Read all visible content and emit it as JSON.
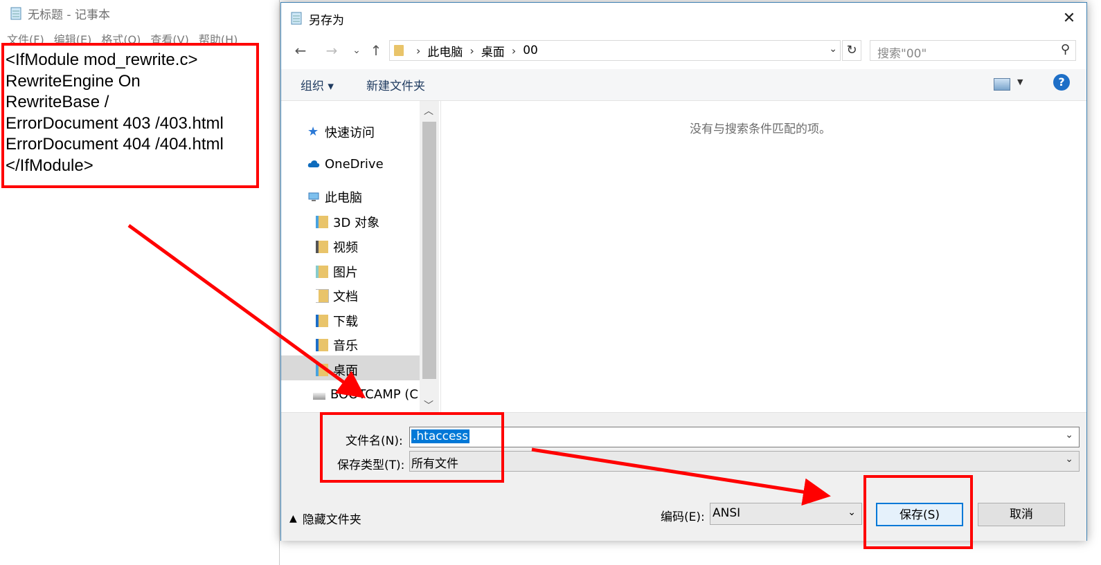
{
  "notepad": {
    "title": "无标题 - 记事本",
    "menu": [
      "文件(F)",
      "编辑(E)",
      "格式(O)",
      "查看(V)",
      "帮助(H)"
    ],
    "text": "<IfModule mod_rewrite.c>\nRewriteEngine On\nRewriteBase /\nErrorDocument 403 /403.html\nErrorDocument 404 /404.html\n</IfModule>"
  },
  "dialog": {
    "title": "另存为",
    "close_label": "✕",
    "nav": {
      "back": "←",
      "forward": "→",
      "recent": "⌄",
      "up": "↑"
    },
    "breadcrumb": [
      "此电脑",
      "桌面",
      "00"
    ],
    "refresh_label": "↻",
    "search_placeholder": "搜索\"00\"",
    "toolbar": {
      "organize": "组织 ▾",
      "new_folder": "新建文件夹",
      "help": "?"
    },
    "nav_pane": {
      "quick_access": "快速访问",
      "onedrive": "OneDrive",
      "this_pc": "此电脑",
      "items": [
        "3D 对象",
        "视频",
        "图片",
        "文档",
        "下载",
        "音乐",
        "桌面",
        "BOOTCAMP (C"
      ]
    },
    "empty_message": "没有与搜索条件匹配的项。",
    "filename_label": "文件名(N):",
    "filename_value": ".htaccess",
    "filetype_label": "保存类型(T):",
    "filetype_value": "所有文件",
    "hide_folders": "隐藏文件夹",
    "encoding_label": "编码(E):",
    "encoding_value": "ANSI",
    "save_button": "保存(S)",
    "cancel_button": "取消"
  },
  "colors": {
    "annotation": "#ff0000",
    "selection": "#0078d7",
    "folder": "#e9c46a"
  }
}
